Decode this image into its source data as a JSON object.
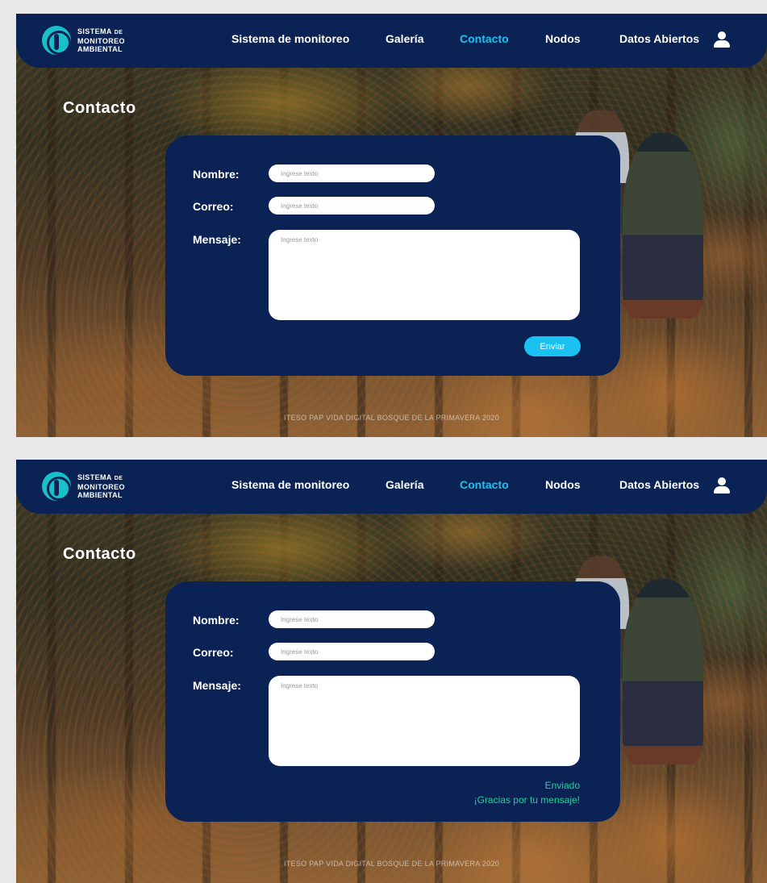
{
  "brand": {
    "line1": "SISTEMA",
    "line1_small": "DE",
    "line2": "MONITOREO",
    "line3": "AMBIENTAL"
  },
  "nav": {
    "items": [
      "Sistema de monitoreo",
      "Galería",
      "Contacto",
      "Nodos",
      "Datos Abiertos"
    ],
    "active": "Contacto",
    "user_icon": "user-icon"
  },
  "page_title": "Contacto",
  "form": {
    "name_label": "Nombre:",
    "email_label": "Correo:",
    "message_label": "Mensaje:",
    "placeholder": "Ingrese texto",
    "submit_label": "Enviar"
  },
  "confirmation": {
    "line1": "Enviado",
    "line2": "¡Gracias por tu mensaje!"
  },
  "footer": "ITESO PAP VIDA DIGITAL BOSQUE DE LA PRIMAVERA 2020",
  "colors": {
    "navy": "#0b2255",
    "accent": "#19c2f0",
    "success": "#1fcf9a"
  }
}
